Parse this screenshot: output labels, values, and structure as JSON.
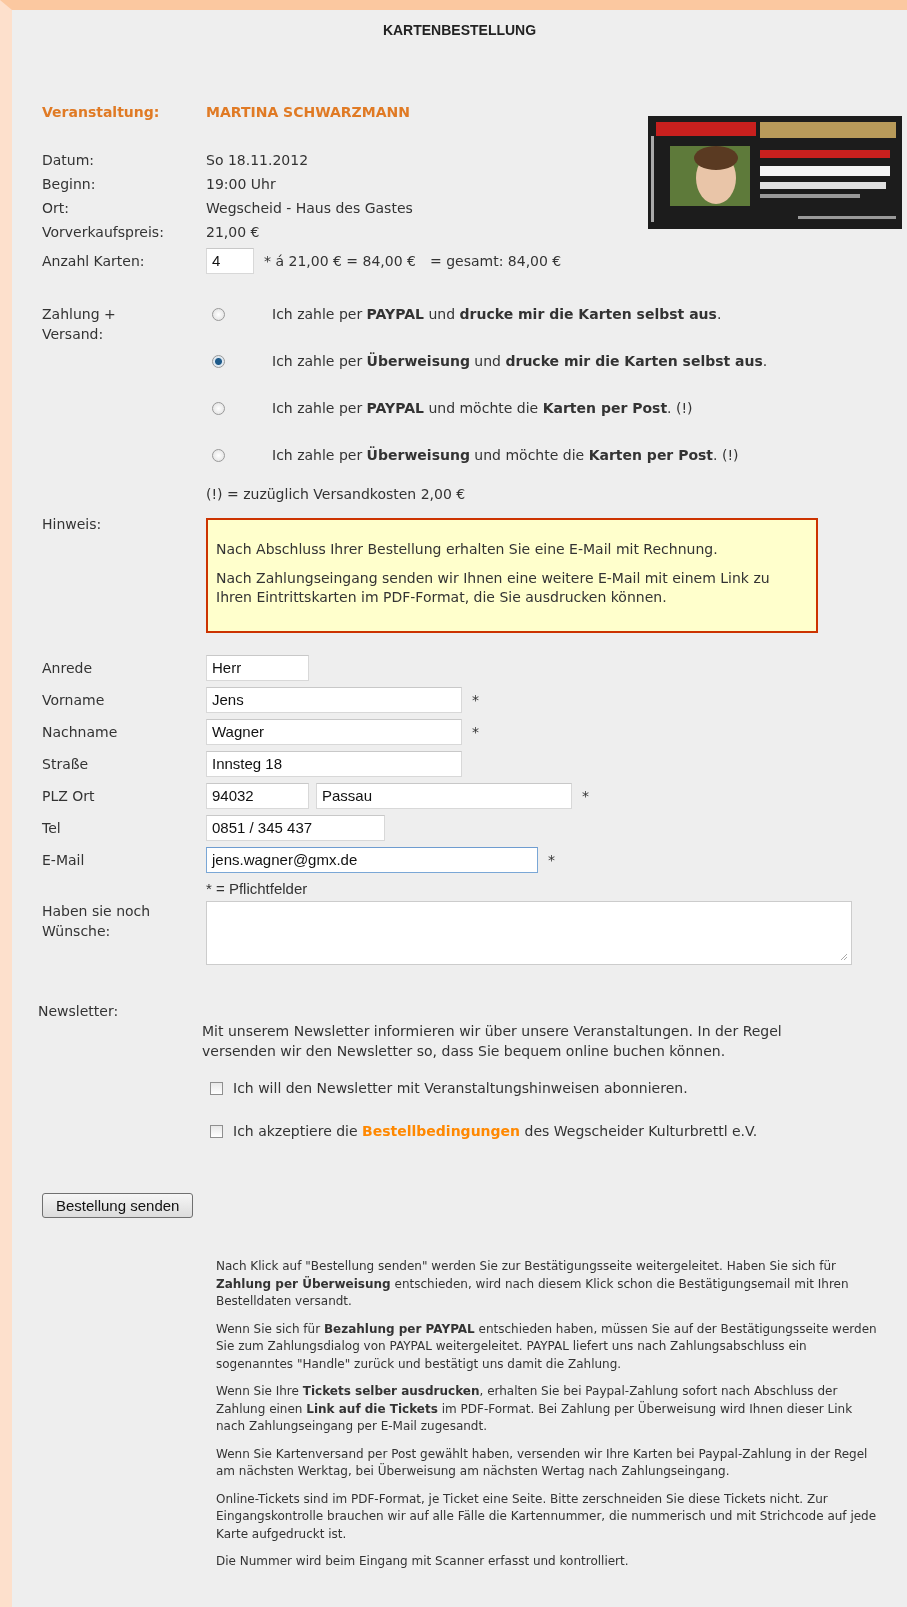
{
  "title": "KARTENBESTELLUNG",
  "event": {
    "label": "Veranstaltung:",
    "value": "MARTINA SCHWARZMANN"
  },
  "details": [
    {
      "label": "Datum:",
      "value": "So 18.11.2012"
    },
    {
      "label": "Beginn:",
      "value": "19:00 Uhr"
    },
    {
      "label": "Ort:",
      "value": "Wegscheid - Haus des Gastes"
    },
    {
      "label": "Vorverkaufspreis:",
      "value": "21,00 €"
    }
  ],
  "tickets": {
    "label": "Anzahl Karten:",
    "value": "4",
    "calc": "*  á 21,00 € = 84,00 €",
    "total": "= gesamt: 84,00 €"
  },
  "payment": {
    "label": "Zahlung + Versand:",
    "options": [
      {
        "text": "Ich zahle per **PAYPAL** und **drucke mir die Karten selbst aus**.",
        "selected": false
      },
      {
        "text": "Ich zahle per **Überweisung** und **drucke mir die Karten selbst aus**.",
        "selected": true
      },
      {
        "text": "Ich zahle per **PAYPAL** und möchte die **Karten per Post**. (!)",
        "selected": false
      },
      {
        "text": "Ich zahle per **Überweisung** und möchte die **Karten per Post**. (!)",
        "selected": false
      }
    ],
    "note": "(!) = zuzüglich Versandkosten 2,00 €"
  },
  "hint": {
    "label": "Hinweis:",
    "paragraphs": [
      "Nach Abschluss Ihrer Bestellung erhalten Sie eine E-Mail mit Rechnung.",
      "Nach Zahlungseingang senden wir Ihnen eine weitere E-Mail mit einem Link zu Ihren Eintrittskarten im PDF-Format, die Sie ausdrucken können."
    ]
  },
  "fields": [
    {
      "label": "Anrede",
      "inputs": [
        {
          "value": "Herr",
          "focused": false
        }
      ]
    },
    {
      "label": "Vorname",
      "inputs": [
        {
          "value": "Jens",
          "focused": false
        }
      ],
      "marker": "*"
    },
    {
      "label": "Nachname",
      "inputs": [
        {
          "value": "Wagner",
          "focused": false
        }
      ],
      "marker": "*"
    },
    {
      "label": "Straße",
      "inputs": [
        {
          "value": "Innsteg 18",
          "focused": false
        }
      ]
    },
    {
      "label": "PLZ Ort",
      "inputs": [
        {
          "value": "94032",
          "focused": false
        },
        {
          "value": "Passau",
          "focused": false
        }
      ],
      "marker": "*"
    },
    {
      "label": "Tel",
      "inputs": [
        {
          "value": "0851 / 345 437",
          "focused": false
        }
      ]
    },
    {
      "label": "E-Mail",
      "inputs": [
        {
          "value": "jens.wagner@gmx.de",
          "focused": true
        }
      ],
      "marker": "*"
    }
  ],
  "required_note": "* = Pflichtfelder",
  "wishes": {
    "label": "Haben sie noch Wünsche:"
  },
  "newsletter": {
    "label": "Newsletter:",
    "text": "Mit unserem Newsletter informieren wir über unsere Veranstaltungen. In der Regel versenden wir den Newsletter so, dass Sie bequem online buchen können.",
    "checkboxes": [
      {
        "before": "Ich will den Newsletter mit Veranstaltungshinweisen abonnieren.",
        "checked": false
      },
      {
        "before": "Ich akzeptiere die",
        "link": "Bestellbedingungen",
        "after": "des Wegscheider Kulturbrettl e.V.",
        "checked": false
      }
    ]
  },
  "submit": "Bestellung senden",
  "info": [
    "Nach Klick auf \"Bestellung senden\" werden Sie zur Bestätigungsseite weitergeleitet. Haben Sie sich für **Zahlung per Überweisung** entschieden, wird nach diesem Klick schon die Bestätigungsemail mit Ihren Bestelldaten versandt.",
    "Wenn Sie sich für **Bezahlung per PAYPAL** entschieden haben, müssen Sie auf der Bestätigungsseite werden Sie zum Zahlungsdialog von PAYPAL weitergeleitet. PAYPAL liefert uns nach Zahlungsabschluss ein sogenanntes \"Handle\" zurück und bestätigt uns damit die Zahlung.",
    "Wenn Sie Ihre **Tickets selber ausdrucken**, erhalten Sie bei Paypal-Zahlung sofort nach Abschluss der Zahlung einen **Link auf die Tickets** im PDF-Format. Bei Zahlung per Überweisung wird Ihnen dieser Link nach Zahlungseingang per E-Mail zugesandt.",
    "Wenn Sie Kartenversand per Post gewählt haben, versenden wir Ihre Karten bei Paypal-Zahlung in der Regel am nächsten Werktag, bei Überweisung am nächsten Wertag nach Zahlungseingang.",
    "Online-Tickets sind im PDF-Format, je Ticket eine Seite. Bitte zerschneiden Sie diese Tickets nicht. Zur Eingangskontrolle brauchen wir auf alle Fälle die Kartennummer, die nummerisch und mit Strichcode auf jede Karte aufgedruckt ist.",
    "Die Nummer wird beim Eingang mit Scanner erfasst und kontrolliert."
  ]
}
